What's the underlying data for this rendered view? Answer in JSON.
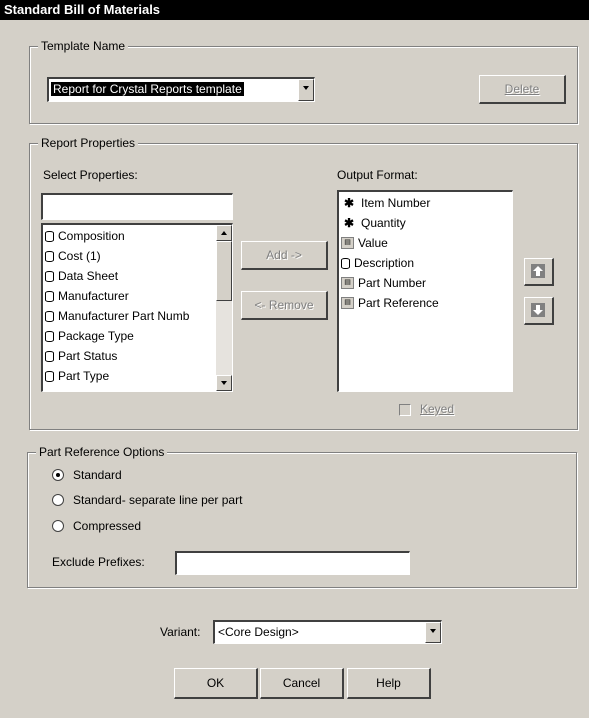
{
  "window": {
    "title": "Standard Bill of Materials"
  },
  "template": {
    "group_label": "Template Name",
    "selected": "Report for Crystal Reports template",
    "delete_label": "Delete"
  },
  "report": {
    "group_label": "Report Properties",
    "select_label": "Select Properties:",
    "search_value": "",
    "available": [
      "Composition",
      "Cost (1)",
      "Data Sheet",
      "Manufacturer",
      "Manufacturer Part Numb",
      "Package Type",
      "Part Status",
      "Part Type"
    ],
    "add_label": "Add ->",
    "remove_label": "<- Remove",
    "output_label": "Output Format:",
    "output": [
      {
        "label": "Item Number",
        "icon": "star-icon"
      },
      {
        "label": "Quantity",
        "icon": "star-icon"
      },
      {
        "label": "Value",
        "icon": "property-value-icon"
      },
      {
        "label": "Description",
        "icon": "database-icon"
      },
      {
        "label": "Part Number",
        "icon": "property-value-icon"
      },
      {
        "label": "Part Reference",
        "icon": "property-value-icon"
      }
    ],
    "keyed_label": "Keyed"
  },
  "part_reference": {
    "group_label": "Part Reference Options",
    "options": [
      "Standard",
      "Standard- separate line per part",
      "Compressed"
    ],
    "selected_index": 0,
    "exclude_label": "Exclude Prefixes:",
    "exclude_value": ""
  },
  "variant": {
    "label": "Variant:",
    "value": "<Core Design>"
  },
  "buttons": {
    "ok": "OK",
    "cancel": "Cancel",
    "help": "Help"
  },
  "colors": {
    "dialog_bg": "#d4d0c8",
    "title_bg": "#000000",
    "title_fg": "#ffffff"
  }
}
